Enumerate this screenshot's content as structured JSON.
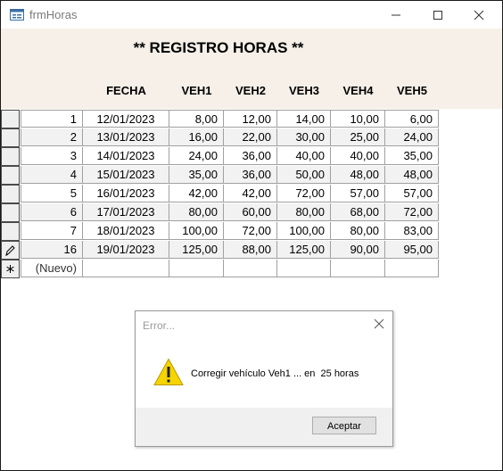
{
  "window": {
    "title": "frmHoras"
  },
  "form": {
    "heading": "** REGISTRO HORAS **",
    "columns": [
      "FECHA",
      "VEH1",
      "VEH2",
      "VEH3",
      "VEH4",
      "VEH5"
    ]
  },
  "table": {
    "rows": [
      {
        "id": "1",
        "fecha": "12/01/2023",
        "veh1": "8,00",
        "veh2": "12,00",
        "veh3": "14,00",
        "veh4": "10,00",
        "veh5": "6,00"
      },
      {
        "id": "2",
        "fecha": "13/01/2023",
        "veh1": "16,00",
        "veh2": "22,00",
        "veh3": "30,00",
        "veh4": "25,00",
        "veh5": "24,00"
      },
      {
        "id": "3",
        "fecha": "14/01/2023",
        "veh1": "24,00",
        "veh2": "36,00",
        "veh3": "40,00",
        "veh4": "40,00",
        "veh5": "35,00"
      },
      {
        "id": "4",
        "fecha": "15/01/2023",
        "veh1": "35,00",
        "veh2": "36,00",
        "veh3": "50,00",
        "veh4": "48,00",
        "veh5": "48,00"
      },
      {
        "id": "5",
        "fecha": "16/01/2023",
        "veh1": "42,00",
        "veh2": "42,00",
        "veh3": "72,00",
        "veh4": "57,00",
        "veh5": "57,00"
      },
      {
        "id": "6",
        "fecha": "17/01/2023",
        "veh1": "80,00",
        "veh2": "60,00",
        "veh3": "80,00",
        "veh4": "68,00",
        "veh5": "72,00"
      },
      {
        "id": "7",
        "fecha": "18/01/2023",
        "veh1": "100,00",
        "veh2": "72,00",
        "veh3": "100,00",
        "veh4": "80,00",
        "veh5": "83,00"
      },
      {
        "id": "16",
        "fecha": "19/01/2023",
        "veh1": "125,00",
        "veh2": "88,00",
        "veh3": "125,00",
        "veh4": "90,00",
        "veh5": "95,00"
      }
    ],
    "new_row_label": "(Nuevo)",
    "editing_row_index": 7
  },
  "dialog": {
    "title": "Error...",
    "message": "Corregir vehículo Veh1 ... en  25 horas",
    "button_label": "Aceptar",
    "icon": "warning-icon"
  },
  "colors": {
    "header_band": "#f6f0e8",
    "alt_row": "#f2f2f2",
    "warning": "#f5d400"
  }
}
